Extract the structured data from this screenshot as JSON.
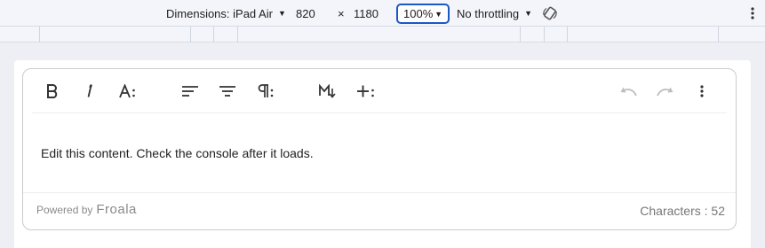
{
  "devtools": {
    "dimensions_label": "Dimensions: iPad Air",
    "width": "820",
    "times": "×",
    "height": "1180",
    "zoom": "100%",
    "throttling": "No throttling"
  },
  "editor": {
    "content": "Edit this content. Check the console after it loads.",
    "powered_by": "Powered by",
    "brand": "Froala",
    "char_count": "Characters : 52"
  },
  "toolbar_icons": [
    "bold-icon",
    "italic-icon",
    "font-size-icon",
    "align-left-icon",
    "align-center-icon",
    "paragraph-format-icon",
    "markdown-icon",
    "more-insert-icon",
    "undo-icon",
    "redo-icon",
    "more-options-icon"
  ]
}
